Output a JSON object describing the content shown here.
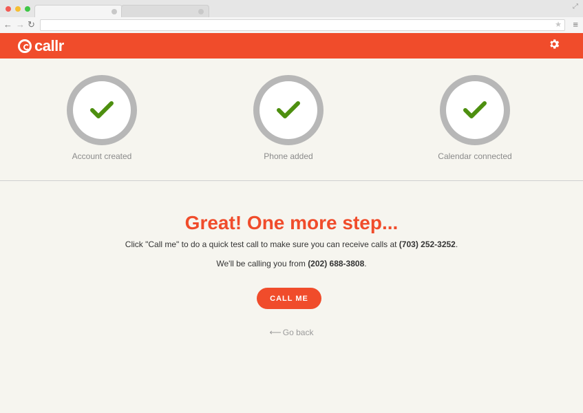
{
  "browser": {
    "nav": {
      "back": "←",
      "forward": "→",
      "reload": "↻",
      "menu": "≡",
      "star": "★",
      "resize": "⤢"
    }
  },
  "app": {
    "brand": "callr",
    "brand_color": "#f04c2b",
    "settings_icon": "gear-icon"
  },
  "steps": [
    {
      "label": "Account created",
      "icon": "check-icon",
      "status": "done"
    },
    {
      "label": "Phone added",
      "icon": "check-icon",
      "status": "done"
    },
    {
      "label": "Calendar connected",
      "icon": "check-icon",
      "status": "done"
    }
  ],
  "main": {
    "headline": "Great! One more step...",
    "instruction_prefix": "Click \"Call me\" to do a quick test call to make sure you can receive calls at ",
    "user_phone": "(703) 252-3252",
    "instruction_suffix": ".",
    "calling_prefix": "We'll be calling you from ",
    "caller_phone": "(202) 688-3808",
    "calling_suffix": ".",
    "call_button": "CALL ME",
    "back_arrow": "⟵",
    "back_link": "Go back"
  }
}
